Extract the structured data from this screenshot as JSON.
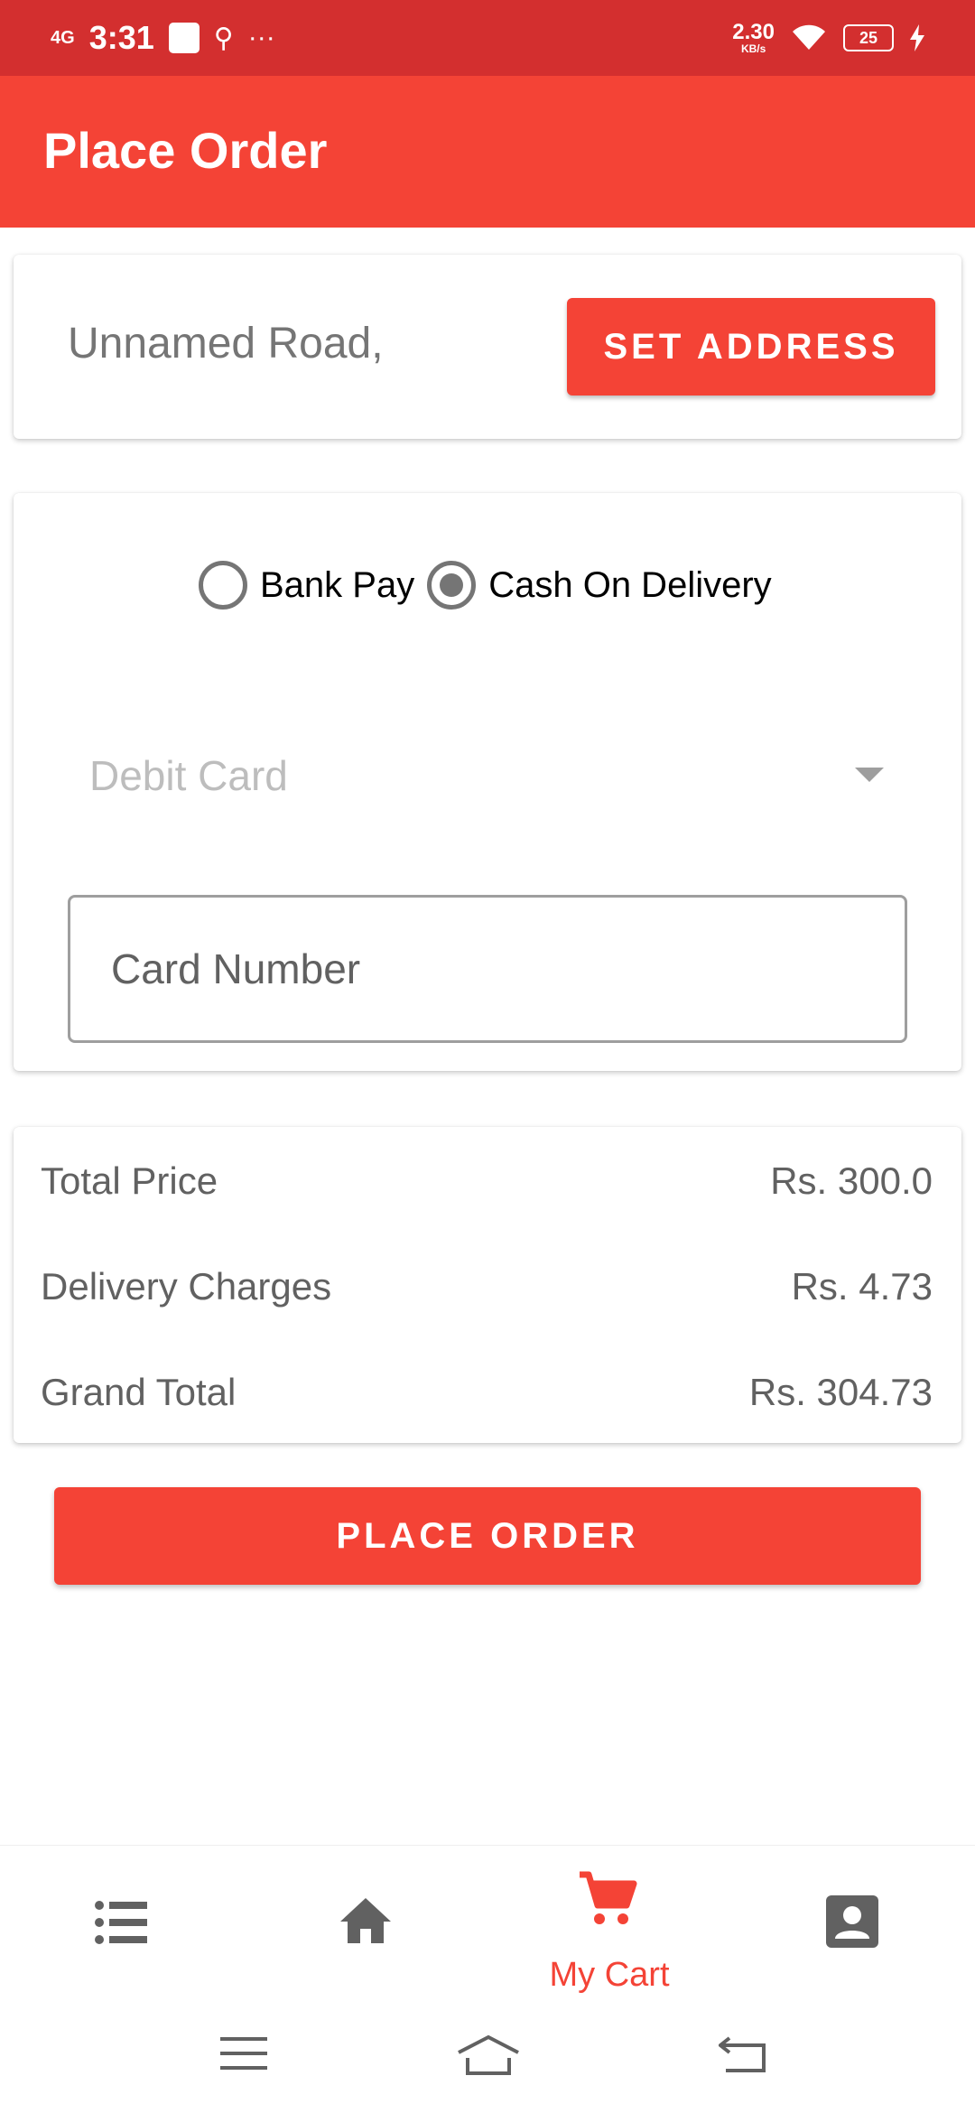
{
  "status_bar": {
    "network": "4G",
    "time": "3:31",
    "more": "···",
    "speed_value": "2.30",
    "speed_unit": "KB/s",
    "battery": "25"
  },
  "app_bar": {
    "title": "Place Order"
  },
  "address": {
    "text": "Unnamed Road,",
    "button_label": "SET ADDRESS"
  },
  "payment": {
    "options": [
      {
        "label": "Bank Pay",
        "selected": false
      },
      {
        "label": "Cash On Delivery",
        "selected": true
      }
    ],
    "card_type": "Debit Card",
    "card_number_placeholder": "Card Number"
  },
  "summary": {
    "rows": [
      {
        "label": "Total Price",
        "value": "Rs. 300.0"
      },
      {
        "label": "Delivery Charges",
        "value": "Rs. 4.73"
      },
      {
        "label": "Grand Total",
        "value": "Rs. 304.73"
      }
    ]
  },
  "place_order_label": "PLACE ORDER",
  "bottom_nav": {
    "items": [
      {
        "icon": "list-icon",
        "label": "",
        "active": false
      },
      {
        "icon": "home-icon",
        "label": "",
        "active": false
      },
      {
        "icon": "cart-icon",
        "label": "My Cart",
        "active": true
      },
      {
        "icon": "account-icon",
        "label": "",
        "active": false
      }
    ]
  },
  "colors": {
    "status_bar": "#d32f2f",
    "primary": "#f44336",
    "icon_inactive": "#616161",
    "text_secondary": "#616161"
  }
}
